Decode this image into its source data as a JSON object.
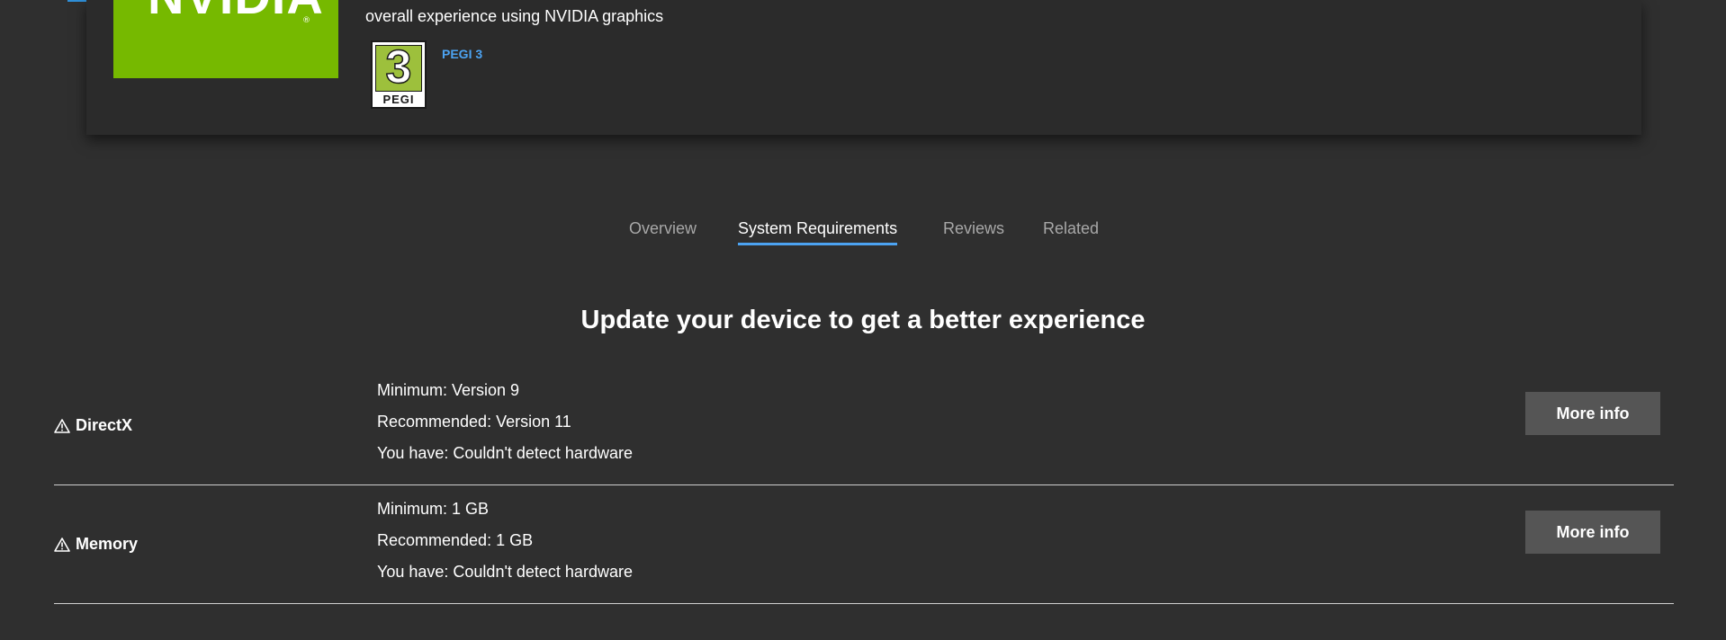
{
  "hero": {
    "logo_text": "NVIDIA",
    "description": "overall experience using NVIDIA graphics",
    "rating": {
      "number": "3",
      "label": "PEGI",
      "link_text": "PEGI 3"
    }
  },
  "tabs": [
    {
      "label": "Overview",
      "active": false
    },
    {
      "label": "System Requirements",
      "active": true
    },
    {
      "label": "Reviews",
      "active": false
    },
    {
      "label": "Related",
      "active": false
    }
  ],
  "heading": "Update your device to get a better experience",
  "requirements": [
    {
      "name": "DirectX",
      "status_icon": "warning-icon",
      "minimum": "Minimum: Version 9",
      "recommended": "Recommended: Version 11",
      "you_have": "You have: Couldn't detect hardware",
      "button_label": "More info"
    },
    {
      "name": "Memory",
      "status_icon": "warning-icon",
      "minimum": "Minimum: 1 GB",
      "recommended": "Recommended: 1 GB",
      "you_have": "You have: Couldn't detect hardware",
      "button_label": "More info"
    }
  ],
  "colors": {
    "background": "#2f2f2f",
    "card": "#2b2b2b",
    "accent_blue": "#4ca3f2",
    "nvidia_green": "#76b900",
    "button": "#555555"
  }
}
